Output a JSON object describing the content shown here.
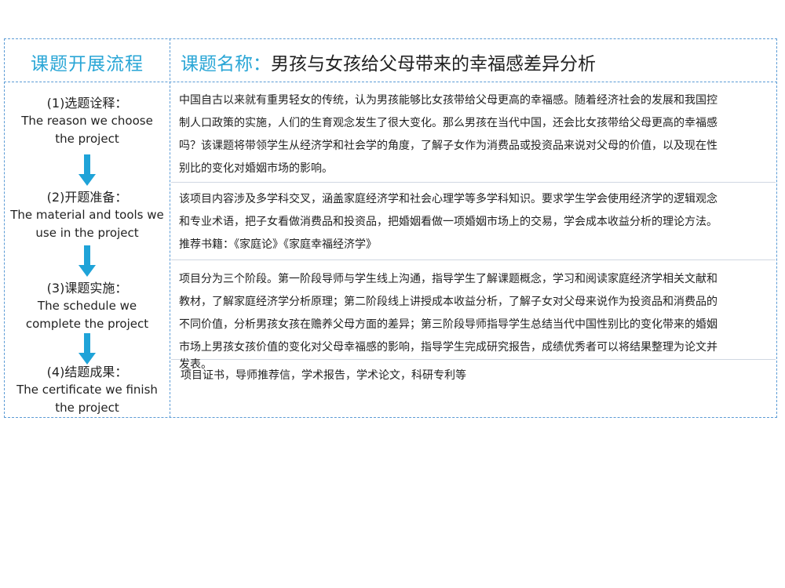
{
  "header": {
    "left_title": "课题开展流程",
    "right_label": "课题名称：",
    "right_title": "男孩与女孩给父母带来的幸福感差异分析"
  },
  "steps": [
    {
      "cn": "(1)选题诠释：",
      "en_lines": [
        "The reason we choose",
        "the project"
      ]
    },
    {
      "cn": "(2)开题准备：",
      "en_lines": [
        "The material and tools we",
        "use in the project"
      ]
    },
    {
      "cn": "(3)课题实施：",
      "en_lines": [
        "The schedule we",
        "complete the project"
      ]
    },
    {
      "cn": "(4)结题成果：",
      "en_lines": [
        "The certificate we finish",
        "the project"
      ]
    }
  ],
  "contents": [
    {
      "lines": [
        "中国自古以来就有重男轻女的传统，认为男孩能够比女孩带给父母更高的幸福感。随着经济社会的发展和我国控",
        "制人口政策的实施，人们的生育观念发生了很大变化。那么男孩在当代中国，还会比女孩带给父母更高的幸福感",
        "吗？该课题将带领学生从经济学和社会学的角度，了解子女作为消费品或投资品来说对父母的价值，以及现在性",
        "别比的变化对婚姻市场的影响。"
      ]
    },
    {
      "lines": [
        "该项目内容涉及多学科交叉，涵盖家庭经济学和社会心理学等多学科知识。要求学生学会使用经济学的逻辑观念",
        "和专业术语，把子女看做消费品和投资品，把婚姻看做一项婚姻市场上的交易，学会成本收益分析的理论方法。",
        "推荐书籍：《家庭论》《家庭幸福经济学》"
      ]
    },
    {
      "lines": [
        "项目分为三个阶段。第一阶段导师与学生线上沟通，指导学生了解课题概念，学习和阅读家庭经济学相关文献和",
        "教材，了解家庭经济学分析原理；第二阶段线上讲授成本收益分析，了解子女对父母来说作为投资品和消费品的",
        "不同价值，分析男孩女孩在赡养父母方面的差异；第三阶段导师指导学生总结当代中国性别比的变化带来的婚姻",
        "市场上男孩女孩价值的变化对父母幸福感的影响，指导学生完成研究报告，成绩优秀者可以将结果整理为论文并",
        "发表。"
      ]
    },
    {
      "lines": [
        "项目证书，导师推荐信，学术报告，学术论文，科研专利等"
      ]
    }
  ],
  "colors": {
    "accent": "#2aa6d6",
    "border": "#5b9bd5",
    "arrow": "#1fa3d8"
  },
  "icons": [
    "arrow-down-icon",
    "arrow-down-icon",
    "arrow-down-icon"
  ]
}
